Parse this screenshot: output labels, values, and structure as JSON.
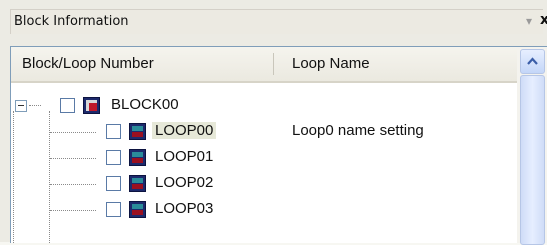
{
  "panel": {
    "title": "Block Information",
    "pin_icon": "pin-down-icon",
    "close_icon": "close-icon",
    "close_glyph": "x",
    "pin_glyph": "▾"
  },
  "columns": {
    "block_loop_number": "Block/Loop Number",
    "loop_name": "Loop Name"
  },
  "tree": {
    "block": {
      "label": "BLOCK00",
      "icon": "block-icon"
    },
    "loops": [
      {
        "label": "LOOP00",
        "name": "Loop0 name setting",
        "selected": true,
        "icon": "loop-icon"
      },
      {
        "label": "LOOP01",
        "name": "",
        "selected": false,
        "icon": "loop-icon"
      },
      {
        "label": "LOOP02",
        "name": "",
        "selected": false,
        "icon": "loop-icon"
      },
      {
        "label": "LOOP03",
        "name": "",
        "selected": false,
        "icon": "loop-icon"
      }
    ]
  },
  "colors": {
    "scroll_accent": "#c4d6f8",
    "block_icon_red": "#c0182a",
    "loop_icon_teal": "#2a8c9a"
  }
}
